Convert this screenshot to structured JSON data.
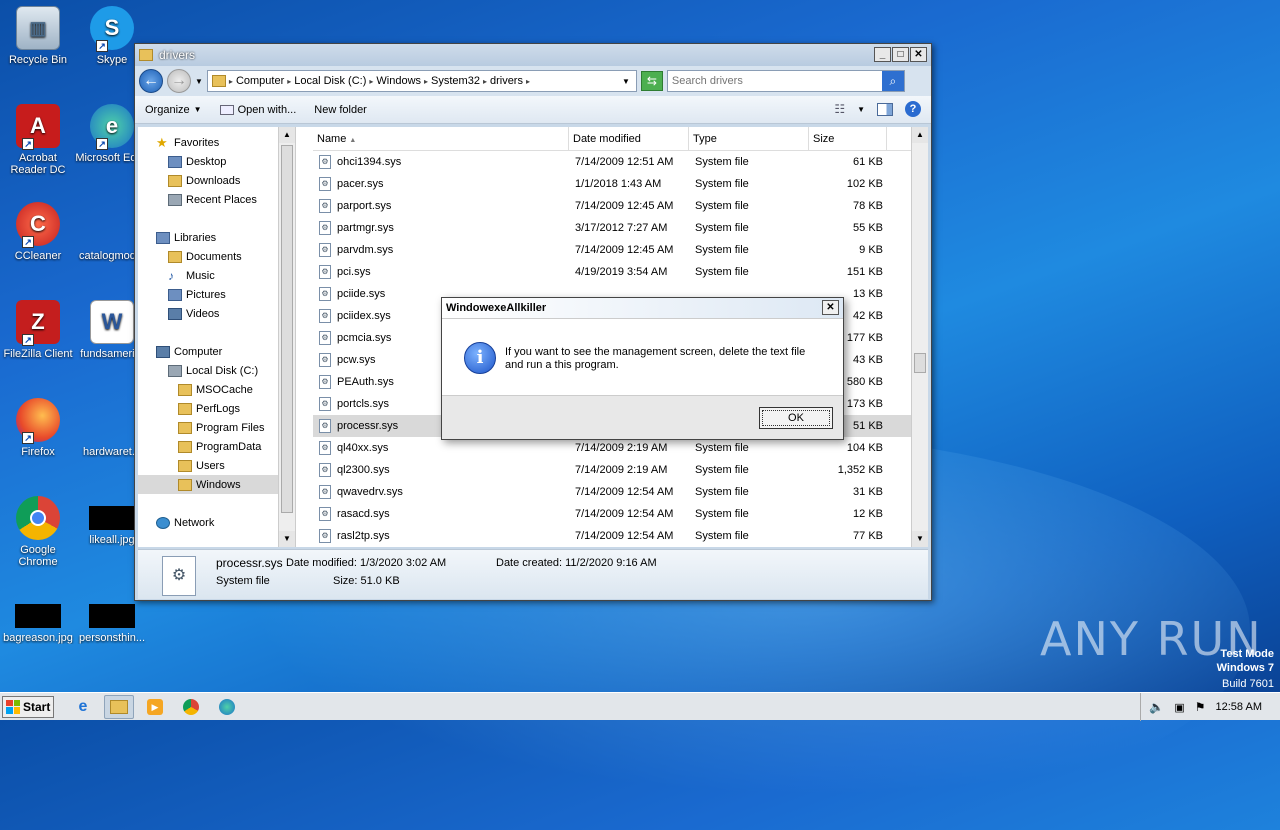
{
  "desktop": {
    "icons": [
      {
        "label": "Recycle Bin"
      },
      {
        "label": "Skype"
      },
      {
        "label": "Acrobat Reader DC"
      },
      {
        "label": "Microsoft Edge"
      },
      {
        "label": "CCleaner"
      },
      {
        "label": "catalogmod..."
      },
      {
        "label": "FileZilla Client"
      },
      {
        "label": "fundsameri..."
      },
      {
        "label": "Firefox"
      },
      {
        "label": "hardwaret..."
      },
      {
        "label": "Google Chrome"
      },
      {
        "label": "likeall.jpg"
      },
      {
        "label": "bagreason.jpg"
      },
      {
        "label": "personsthin..."
      }
    ],
    "watermark": "ANY RUN",
    "test_mode": {
      "line1": "Test Mode",
      "line2": "Windows 7",
      "line3": "Build 7601"
    }
  },
  "explorer": {
    "title": "drivers",
    "breadcrumb": [
      "Computer",
      "Local Disk (C:)",
      "Windows",
      "System32",
      "drivers"
    ],
    "search_placeholder": "Search drivers",
    "toolbar": {
      "organize": "Organize",
      "open_with": "Open with...",
      "new_folder": "New folder"
    },
    "nav": {
      "favorites": "Favorites",
      "desktop": "Desktop",
      "downloads": "Downloads",
      "recent": "Recent Places",
      "libraries": "Libraries",
      "documents": "Documents",
      "music": "Music",
      "pictures": "Pictures",
      "videos": "Videos",
      "computer": "Computer",
      "local_disk": "Local Disk (C:)",
      "msocache": "MSOCache",
      "perflogs": "PerfLogs",
      "program_files": "Program Files",
      "programdata": "ProgramData",
      "users": "Users",
      "windows": "Windows",
      "network": "Network"
    },
    "columns": {
      "name": "Name",
      "date": "Date modified",
      "type": "Type",
      "size": "Size"
    },
    "files": [
      {
        "name": "ohci1394.sys",
        "date": "7/14/2009 12:51 AM",
        "type": "System file",
        "size": "61 KB"
      },
      {
        "name": "pacer.sys",
        "date": "1/1/2018 1:43 AM",
        "type": "System file",
        "size": "102 KB"
      },
      {
        "name": "parport.sys",
        "date": "7/14/2009 12:45 AM",
        "type": "System file",
        "size": "78 KB"
      },
      {
        "name": "partmgr.sys",
        "date": "3/17/2012 7:27 AM",
        "type": "System file",
        "size": "55 KB"
      },
      {
        "name": "parvdm.sys",
        "date": "7/14/2009 12:45 AM",
        "type": "System file",
        "size": "9 KB"
      },
      {
        "name": "pci.sys",
        "date": "4/19/2019 3:54 AM",
        "type": "System file",
        "size": "151 KB"
      },
      {
        "name": "pciide.sys",
        "date": "",
        "type": "",
        "size": "13 KB"
      },
      {
        "name": "pciidex.sys",
        "date": "",
        "type": "",
        "size": "42 KB"
      },
      {
        "name": "pcmcia.sys",
        "date": "",
        "type": "",
        "size": "177 KB"
      },
      {
        "name": "pcw.sys",
        "date": "",
        "type": "",
        "size": "43 KB"
      },
      {
        "name": "PEAuth.sys",
        "date": "",
        "type": "",
        "size": "580 KB"
      },
      {
        "name": "portcls.sys",
        "date": "",
        "type": "",
        "size": "173 KB"
      },
      {
        "name": "processr.sys",
        "date": "",
        "type": "",
        "size": "51 KB"
      },
      {
        "name": "ql40xx.sys",
        "date": "7/14/2009 2:19 AM",
        "type": "System file",
        "size": "104 KB"
      },
      {
        "name": "ql2300.sys",
        "date": "7/14/2009 2:19 AM",
        "type": "System file",
        "size": "1,352 KB"
      },
      {
        "name": "qwavedrv.sys",
        "date": "7/14/2009 12:54 AM",
        "type": "System file",
        "size": "31 KB"
      },
      {
        "name": "rasacd.sys",
        "date": "7/14/2009 12:54 AM",
        "type": "System file",
        "size": "12 KB"
      },
      {
        "name": "rasl2tp.sys",
        "date": "7/14/2009 12:54 AM",
        "type": "System file",
        "size": "77 KB"
      }
    ],
    "details": {
      "name": "processr.sys",
      "modified": "Date modified: 1/3/2020 3:02 AM",
      "created": "Date created: 11/2/2020 9:16 AM",
      "type": "System file",
      "size": "Size: 51.0 KB"
    }
  },
  "dialog": {
    "title": "WindowexeAllkiller",
    "message": "If you want to see the management screen, delete the text file and run a this program.",
    "ok": "OK"
  },
  "taskbar": {
    "start": "Start",
    "clock": "12:58 AM"
  }
}
